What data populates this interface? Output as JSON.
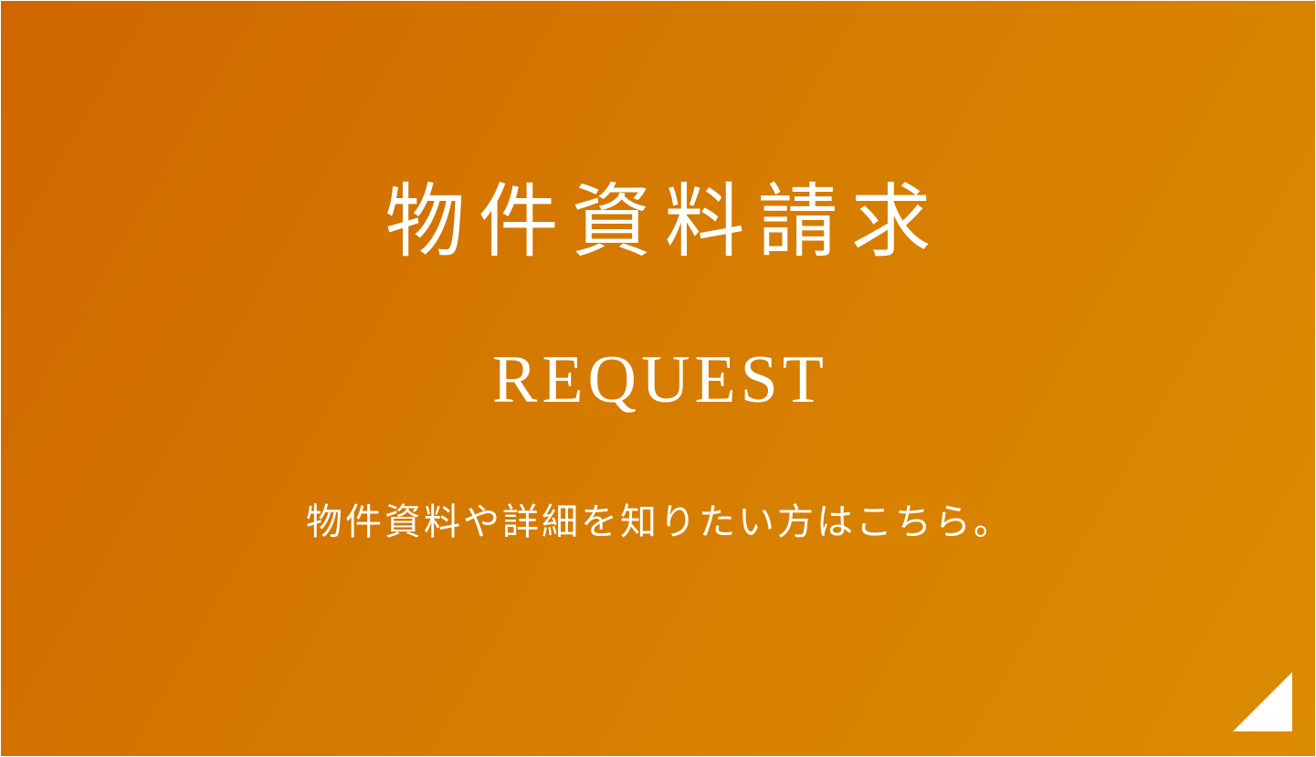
{
  "banner": {
    "title": "物件資料請求",
    "subtitle": "REQUEST",
    "description": "物件資料や詳細を知りたい方はこちら。",
    "icon": "corner-triangle-arrow-icon",
    "colors": {
      "gradient_start": "#cf6700",
      "gradient_end": "#dc8c00",
      "text": "#ffffff"
    }
  }
}
